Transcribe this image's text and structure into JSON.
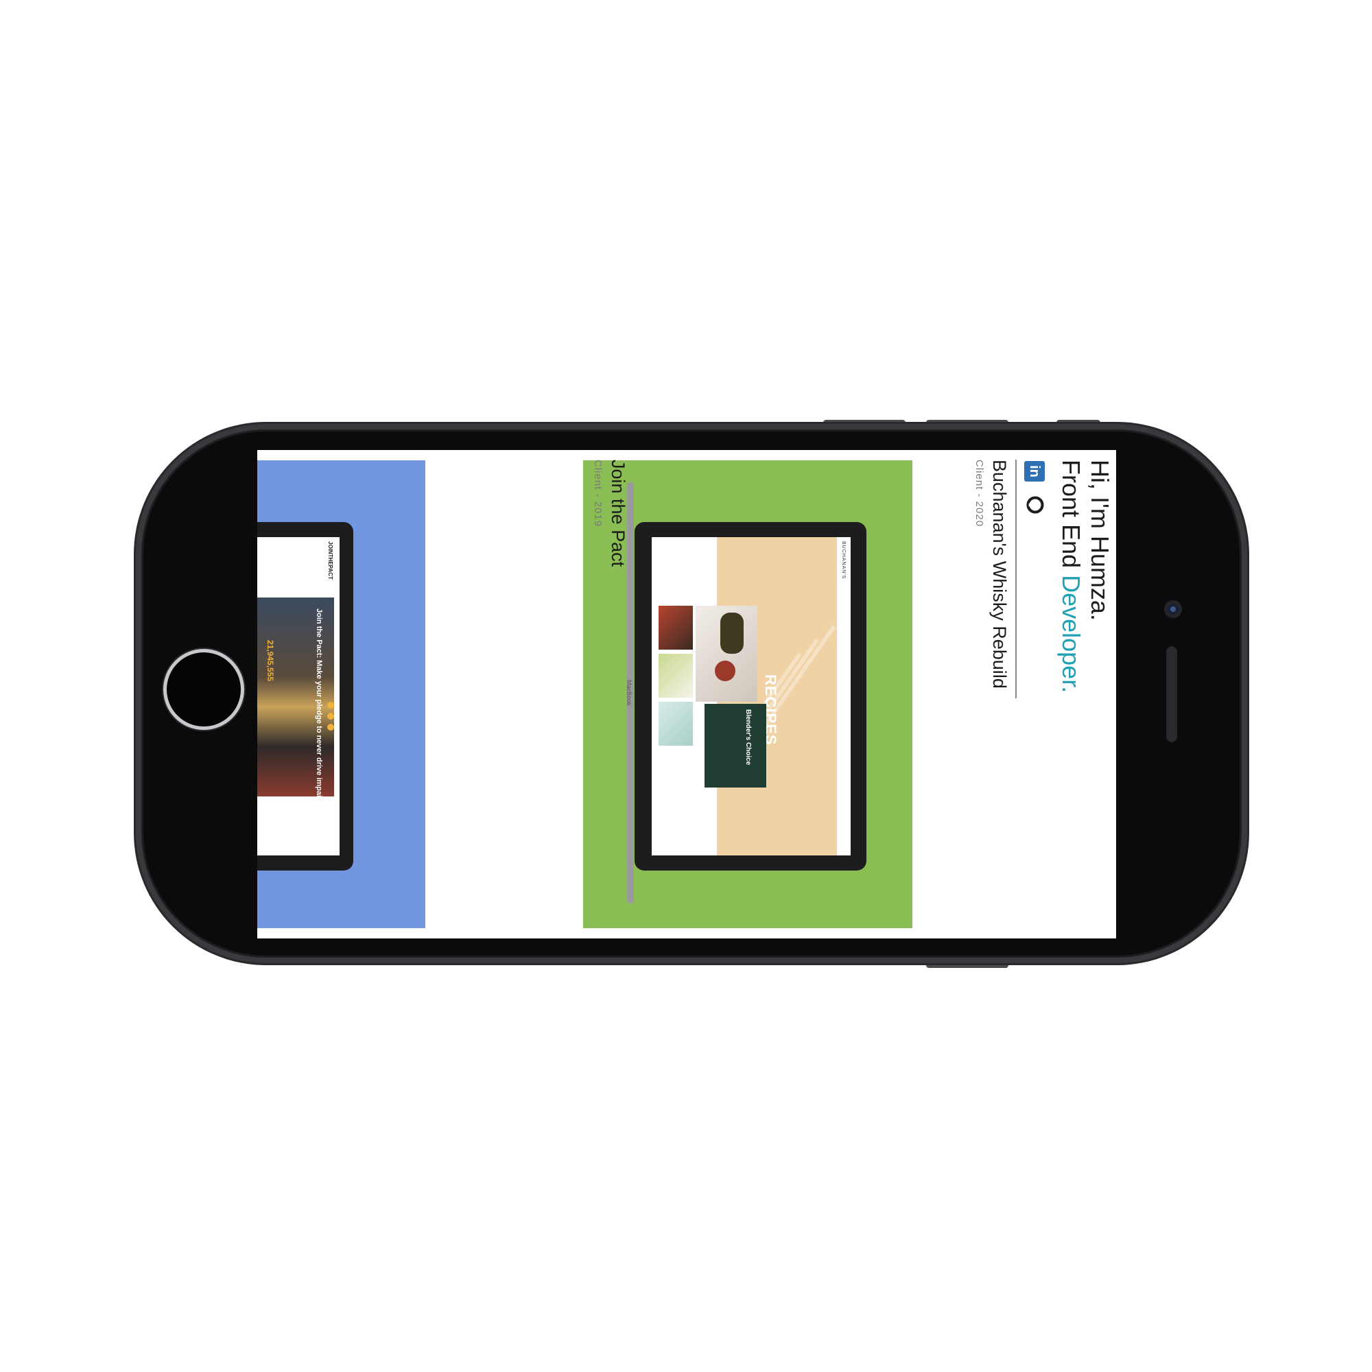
{
  "hero": {
    "greeting": "Hi, I'm Humza.",
    "role_prefix": "Front End ",
    "role_accent": "Developer."
  },
  "projects": [
    {
      "title": "Buchanan's Whisky Rebuild",
      "meta": "Client - 2020",
      "card_color": "#8bbd55"
    },
    {
      "title": "Join the Pact",
      "meta": "Client - 2019",
      "card_color": "#7297e0"
    }
  ],
  "preview_buchanans": {
    "logo": "BUCHANAN'S",
    "heading": "RECIPES",
    "card_title": "Blender's Choice",
    "laptop_brand": "MacBook"
  },
  "preview_pact": {
    "brand": "JOINTHEPACT",
    "headline": "Join the Pact: Make your pledge to never drive impaired.",
    "count": "21,945,555"
  },
  "icons": [
    "linkedin-icon",
    "github-icon"
  ],
  "colors": {
    "accent": "#1fa0b3",
    "green_card": "#8bbd55",
    "blue_card": "#7297e0"
  }
}
